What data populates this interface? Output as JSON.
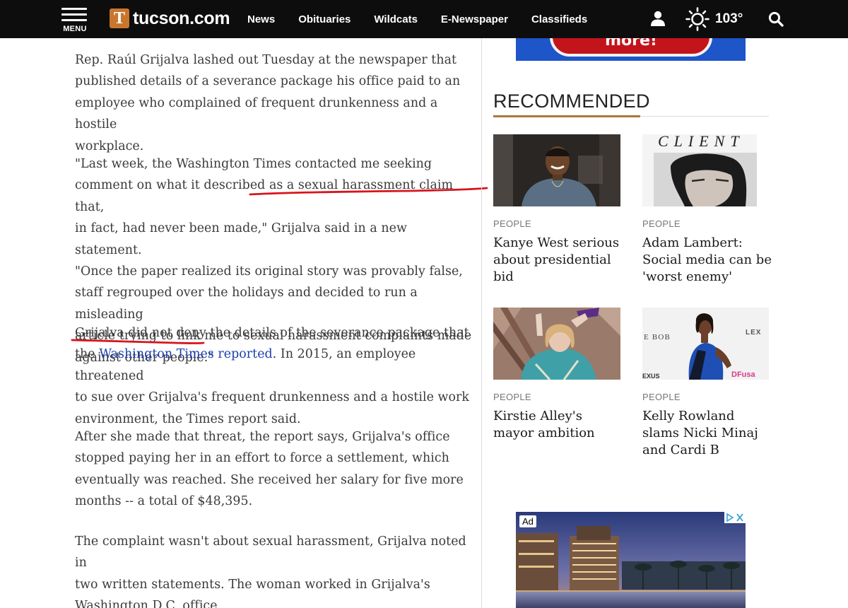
{
  "nav": {
    "menu_label": "MENU",
    "logo_text": "tucson.com",
    "links": [
      "News",
      "Obituaries",
      "Wildcats",
      "E-Newspaper",
      "Classifieds"
    ],
    "temperature": "103°"
  },
  "article": {
    "paragraphs": [
      {
        "lines": [
          "Rep. Raúl Grijalva lashed out Tuesday at the newspaper that",
          "published details of a severance package his office paid to an",
          "employee who complained of frequent drunkenness and a hostile",
          "workplace."
        ]
      },
      {
        "lines": [
          "\"Last week, the Washington Times contacted me seeking",
          "comment on what it described as a sexual harassment claim that,",
          "in fact, had never been made,\" Grijalva said in a new statement.",
          "\"Once the paper realized its original story was provably false,",
          "staff regrouped over the holidays and decided to run a misleading",
          "article trying to link me to sexual harassment complaints made",
          "against other people.\""
        ]
      },
      {
        "line1": "Grijalva did not deny the details of the severance package that",
        "line2_before": "the ",
        "link_text": "Washington Times reported",
        "line2_after": ". In 2015, an employee threatened",
        "lines_rest": [
          "to sue over Grijalva's frequent drunkenness and a hostile work",
          "environment, the Times report said."
        ]
      },
      {
        "lines": [
          "After she made that threat, the report says, Grijalva's office",
          "stopped paying her in an effort to force a settlement, which",
          "eventually was reached. She received her salary for five more",
          "months -- a total of $48,395."
        ]
      },
      {
        "lines": [
          "The complaint wasn't about sexual harassment, Grijalva noted in",
          "two written statements. The woman worked in Grijalva's",
          "Washington D.C. office."
        ]
      }
    ]
  },
  "ads": {
    "top_text": "Click to learn more!",
    "bottom_label": "Ad"
  },
  "recommended": {
    "title": "RECOMMENDED",
    "cards": [
      {
        "category": "PEOPLE",
        "headline": "Kanye West serious about presidential bid"
      },
      {
        "category": "PEOPLE",
        "headline": "Adam Lambert: Social media can be 'worst enemy'",
        "image_text": "CLIENT"
      },
      {
        "category": "PEOPLE",
        "headline": "Kirstie Alley's mayor ambition"
      },
      {
        "category": "PEOPLE",
        "headline": "Kelly Rowland slams Nicki Minaj and Cardi B",
        "image_text_left": "E BOB",
        "image_text_right": "LEX",
        "image_text_bottom": "EXUS",
        "image_text_pink": "DFusa"
      }
    ]
  }
}
